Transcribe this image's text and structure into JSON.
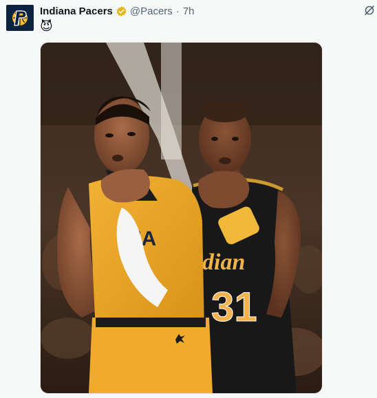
{
  "tweet": {
    "display_name": "Indiana Pacers",
    "handle": "@Pacers",
    "separator": "·",
    "time": "7h",
    "text": "😈",
    "image": {
      "left_jersey_letters": "NA",
      "right_jersey_word": "dian",
      "right_jersey_number": "31"
    }
  },
  "colors": {
    "pacers_navy": "#0c2340",
    "pacers_gold": "#fdbb30",
    "verified_gold": "#e2b719",
    "muted_text": "#536471"
  },
  "icons": {
    "avatar_logo": "pacers-p-logo",
    "verified": "gold-checkmark-badge",
    "header_action": "grok-icon"
  }
}
